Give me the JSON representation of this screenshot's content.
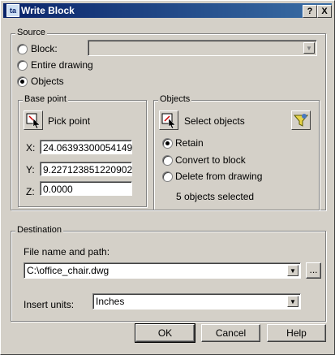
{
  "window": {
    "title": "Write Block",
    "help_btn": "?",
    "close_btn": "X"
  },
  "source": {
    "label": "Source",
    "block_label": "Block:",
    "block_value": "",
    "entire_label": "Entire drawing",
    "objects_label": "Objects",
    "selected": "Objects"
  },
  "base_point": {
    "label": "Base point",
    "pick_label": "Pick point",
    "x_label": "X:",
    "x_value": "24.06393300054149",
    "y_label": "Y:",
    "y_value": "9.227123851220902",
    "z_label": "Z:",
    "z_value": "0.0000"
  },
  "objects": {
    "label": "Objects",
    "select_label": "Select objects",
    "retain_label": "Retain",
    "convert_label": "Convert to block",
    "delete_label": "Delete from drawing",
    "selected_option": "Retain",
    "status": "5 objects selected"
  },
  "destination": {
    "label": "Destination",
    "path_label": "File name and path:",
    "path_value": "C:\\office_chair.dwg",
    "browse_label": "...",
    "units_label": "Insert units:",
    "units_value": "Inches"
  },
  "buttons": {
    "ok": "OK",
    "cancel": "Cancel",
    "help": "Help"
  }
}
